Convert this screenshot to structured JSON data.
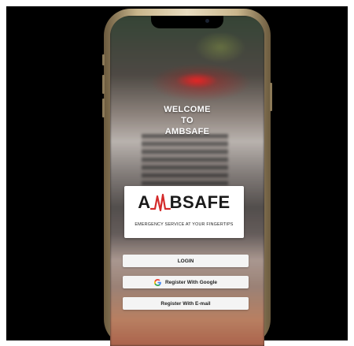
{
  "welcome": {
    "line1": "WELCOME",
    "line2": "TO",
    "line3": "AMBSAFE"
  },
  "brand": {
    "logo_left": "A",
    "logo_right": "BSAFE",
    "tagline": "EMERGENCY SERVICE AT YOUR FINGERTIPS",
    "accent_color": "#d42a2a"
  },
  "buttons": {
    "login_label": "LOGIN",
    "google_label": "Register With Google",
    "email_label": "Register With E-mail"
  },
  "icons": {
    "google": "google-g-icon",
    "logo_mark": "heartbeat-m-icon"
  }
}
